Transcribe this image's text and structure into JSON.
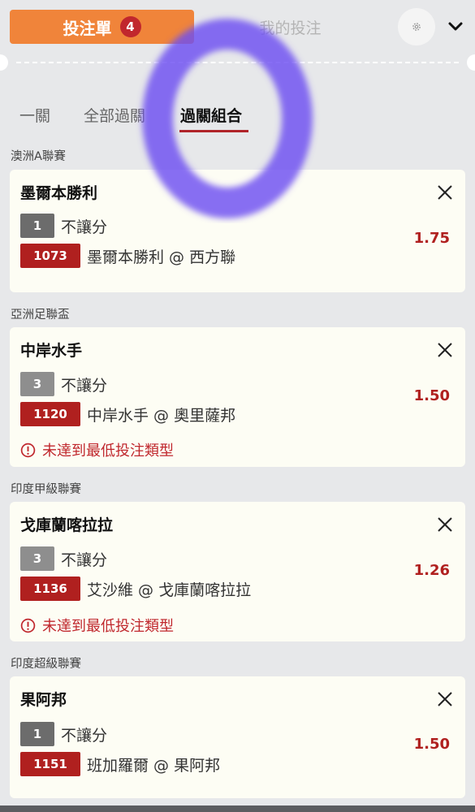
{
  "header": {
    "betslip_tab": {
      "label": "投注單",
      "count": "4"
    },
    "mybets_tab": {
      "label": "我的投注"
    },
    "settings_icon": "gear-icon",
    "collapse_icon": "chevron-down-icon"
  },
  "bet_types": [
    {
      "label": "一關"
    },
    {
      "label": "全部過關"
    },
    {
      "label": "過關組合",
      "active": true
    }
  ],
  "bets": [
    {
      "league": "澳洲A聯賽",
      "team": "墨爾本勝利",
      "num": "1",
      "market": "不讓分",
      "match_no": "1073",
      "match": "墨爾本勝利 @ 西方聯",
      "odds": "1.75",
      "warning": ""
    },
    {
      "league": "亞洲足聯盃",
      "team": "中岸水手",
      "num": "3",
      "market": "不讓分",
      "match_no": "1120",
      "match": "中岸水手 @ 奧里薩邦",
      "odds": "1.50",
      "warning": "未達到最低投注類型"
    },
    {
      "league": "印度甲級聯賽",
      "team": "戈庫蘭喀拉拉",
      "num": "3",
      "market": "不讓分",
      "match_no": "1136",
      "match": "艾沙維 @ 戈庫蘭喀拉拉",
      "odds": "1.26",
      "warning": "未達到最低投注類型"
    },
    {
      "league": "印度超級聯賽",
      "team": "果阿邦",
      "num": "1",
      "market": "不讓分",
      "match_no": "1151",
      "match": "班加羅爾 @ 果阿邦",
      "odds": "1.50",
      "warning": ""
    }
  ],
  "colors": {
    "accent_orange": "#f0843a",
    "brand_red": "#b0201f",
    "card_bg": "#fdfdf4",
    "page_bg": "#e7e8ea",
    "overlay_purple": "#6c4ef2"
  }
}
